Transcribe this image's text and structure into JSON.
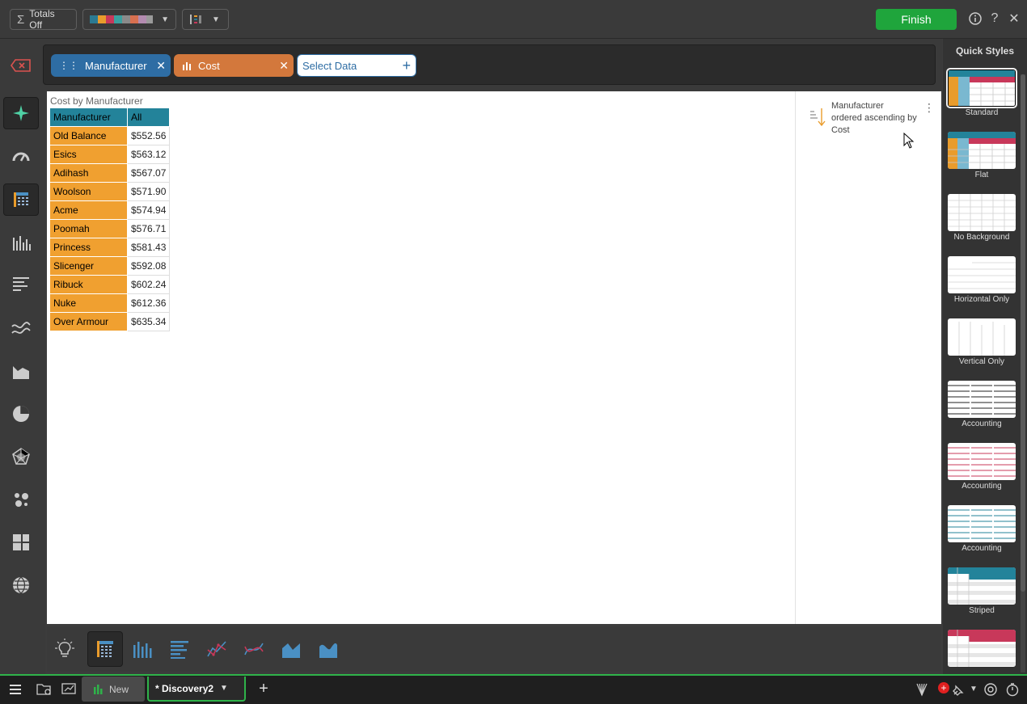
{
  "toolbar": {
    "totals_label": "Totals Off",
    "finish_label": "Finish"
  },
  "filters": {
    "chip1": "Manufacturer",
    "chip2": "Cost",
    "select_data": "Select Data",
    "chip1_color": "#2e6da4",
    "chip2_color": "#d3783c"
  },
  "chart": {
    "title": "Cost by Manufacturer"
  },
  "chart_data": {
    "type": "table",
    "title": "Cost by Manufacturer",
    "columns": [
      "Manufacturer",
      "All"
    ],
    "rows": [
      [
        "Old Balance",
        "$552.56"
      ],
      [
        "Esics",
        "$563.12"
      ],
      [
        "Adihash",
        "$567.07"
      ],
      [
        "Woolson",
        "$571.90"
      ],
      [
        "Acme",
        "$574.94"
      ],
      [
        "Poomah",
        "$576.71"
      ],
      [
        "Princess",
        "$581.43"
      ],
      [
        "Slicenger",
        "$592.08"
      ],
      [
        "Ribuck",
        "$602.24"
      ],
      [
        "Nuke",
        "$612.36"
      ],
      [
        "Over Armour",
        "$635.34"
      ]
    ]
  },
  "sort": {
    "line1": "Manufacturer",
    "line2": "ordered ascending by",
    "line3": "Cost"
  },
  "quick_styles": {
    "title": "Quick Styles",
    "items": [
      "Standard",
      "Flat",
      "No Background",
      "Horizontal Only",
      "Vertical Only",
      "Accounting",
      "Accounting",
      "Accounting",
      "Striped"
    ]
  },
  "taskbar": {
    "tab_new": "New",
    "tab_active": "* Discovery2"
  },
  "colors": {
    "accent_green": "#1fa53c",
    "header_teal": "#23839a",
    "row_orange": "#f0a030",
    "style_red": "#c8385a"
  }
}
